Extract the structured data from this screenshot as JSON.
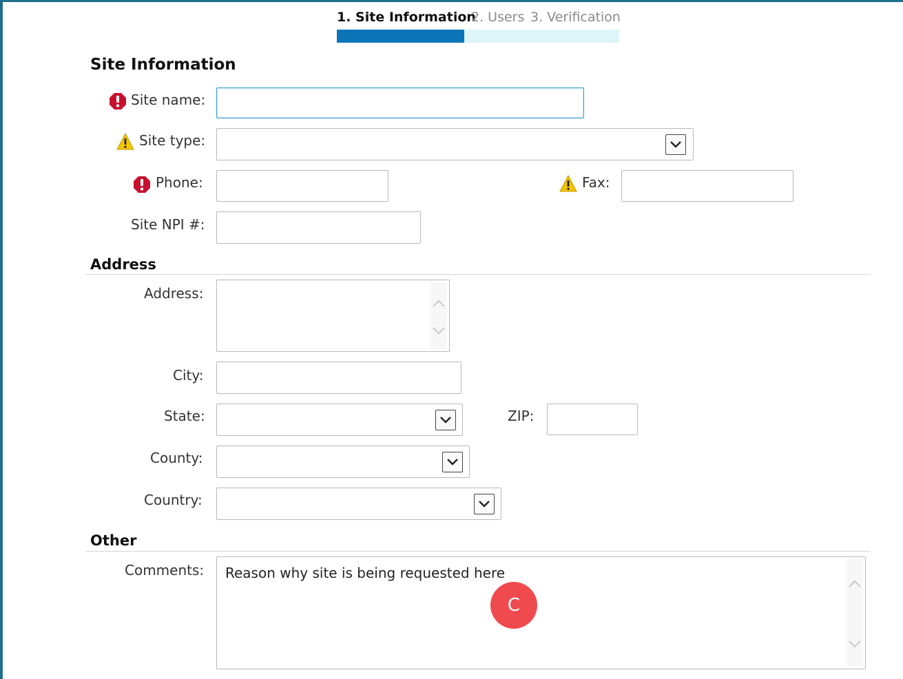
{
  "steps": [
    {
      "label": "1. Site Information",
      "active": true
    },
    {
      "label": "2. Users",
      "active": false
    },
    {
      "label": "3. Verification",
      "active": false
    }
  ],
  "progress": {
    "fraction": 0.45,
    "fill_color": "#0b75b8",
    "track_color": "#ddf5f8"
  },
  "sections": {
    "site_information": {
      "title": "Site Information",
      "site_name_label": "Site name:",
      "site_name_value": "",
      "site_type_label": "Site type:",
      "site_type_value": "",
      "phone_label": "Phone:",
      "phone_value": "",
      "fax_label": "Fax:",
      "fax_value": "",
      "npi_label": "Site NPI #:",
      "npi_value": ""
    },
    "address": {
      "title": "Address",
      "address_label": "Address:",
      "address_value": "",
      "city_label": "City:",
      "city_value": "",
      "state_label": "State:",
      "state_value": "",
      "zip_label": "ZIP:",
      "zip_value": "",
      "county_label": "County:",
      "county_value": "",
      "country_label": "Country:",
      "country_value": ""
    },
    "other": {
      "title": "Other",
      "comments_label": "Comments:",
      "comments_value": "Reason why site is being requested here"
    }
  },
  "icons": {
    "required": "required-exclamation-icon",
    "warning": "warning-triangle-icon",
    "dropdown": "chevron-down-icon"
  },
  "colors": {
    "frame": "#1f6e8c",
    "required": "#c8102e",
    "warning": "#f5c400",
    "badge": "#ef4b4f"
  },
  "annotation_badge": "C"
}
